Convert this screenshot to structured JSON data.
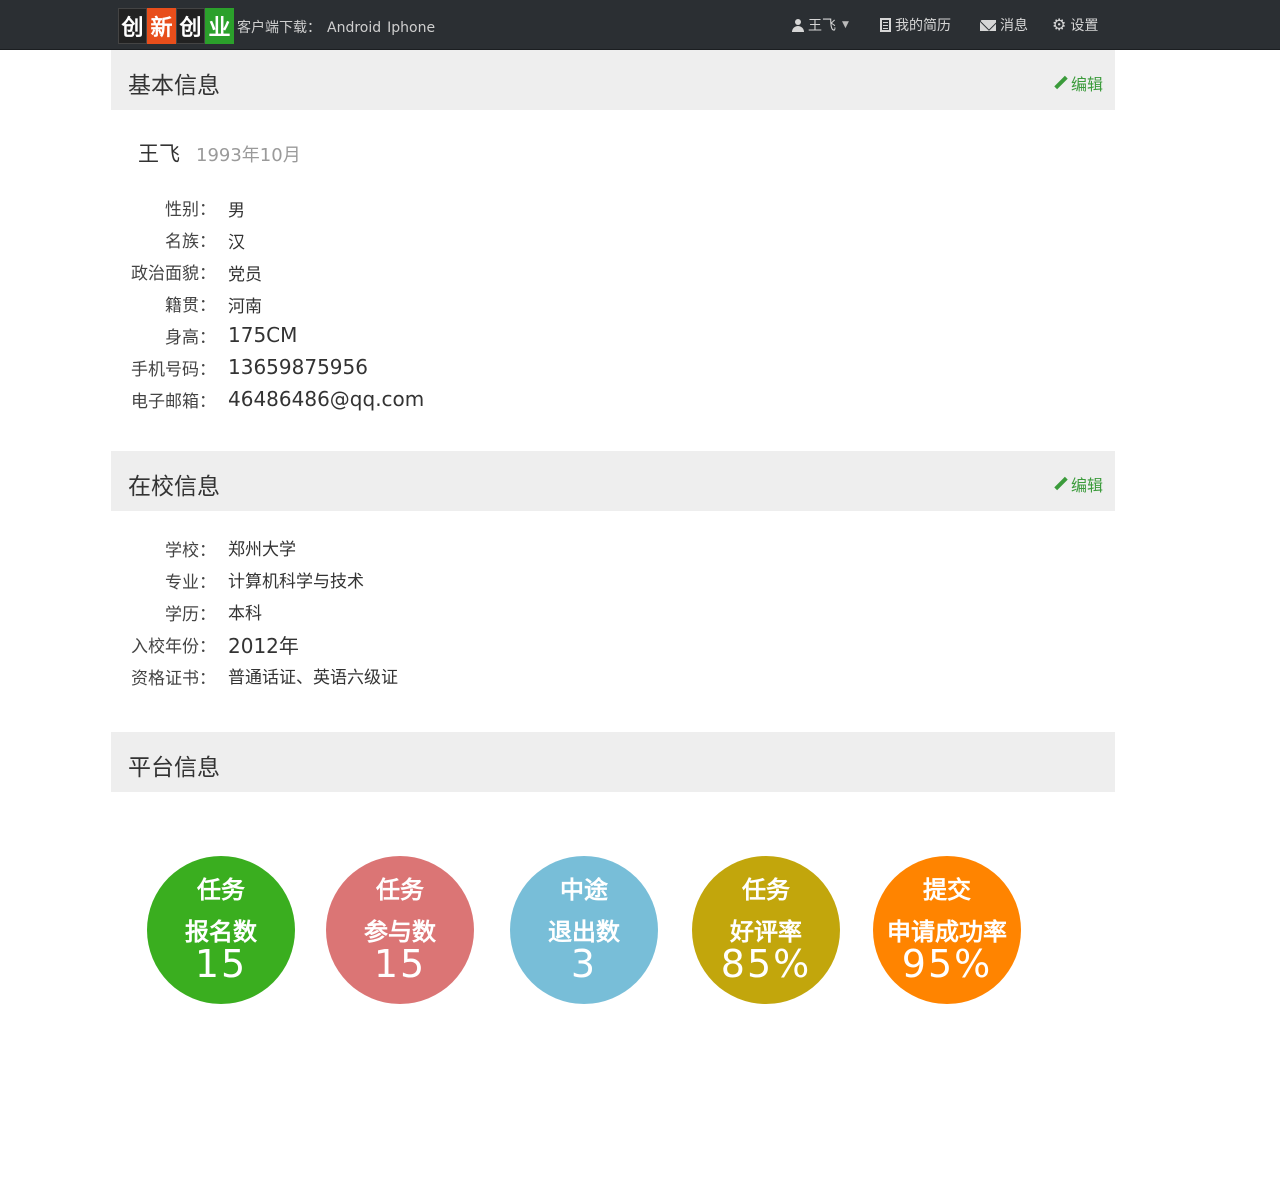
{
  "navbar": {
    "logo_chars": [
      "创",
      "新",
      "创",
      "业"
    ],
    "download_label": "客户端下载：",
    "download_android": "Android",
    "download_iphone": "Iphone",
    "user_name": "王飞",
    "caret": "▼",
    "resume": "我的简历",
    "messages": "消息",
    "settings": "设置"
  },
  "basic": {
    "title": "基本信息",
    "edit": "编辑",
    "name": "王飞",
    "birth": "1993年10月",
    "fields": [
      {
        "label": "性别：",
        "value": "男"
      },
      {
        "label": "名族：",
        "value": "汉"
      },
      {
        "label": "政治面貌：",
        "value": "党员"
      },
      {
        "label": "籍贯：",
        "value": "河南"
      },
      {
        "label": "身高：",
        "value": "175CM"
      },
      {
        "label": "手机号码：",
        "value": "13659875956"
      },
      {
        "label": "电子邮箱：",
        "value": "46486486@qq.com"
      }
    ]
  },
  "school": {
    "title": "在校信息",
    "edit": "编辑",
    "fields": [
      {
        "label": "学校：",
        "value": "郑州大学"
      },
      {
        "label": "专业：",
        "value": "计算机科学与技术"
      },
      {
        "label": "学历：",
        "value": "本科"
      },
      {
        "label": "入校年份：",
        "value": "2012年"
      },
      {
        "label": "资格证书：",
        "value": "普通话证、英语六级证"
      }
    ]
  },
  "platform": {
    "title": "平台信息",
    "stats": [
      {
        "line1": "任务",
        "line2": "报名数",
        "value": "15",
        "color": "#3aae1f"
      },
      {
        "line1": "任务",
        "line2": "参与数",
        "value": "15",
        "color": "#db7575"
      },
      {
        "line1": "中途",
        "line2": "退出数",
        "value": "3",
        "color": "#78bed8"
      },
      {
        "line1": "任务",
        "line2": "好评率",
        "value": "85%",
        "color": "#c2a60c"
      },
      {
        "line1": "提交",
        "line2": "申请成功率",
        "value": "95%",
        "color": "#ff8400"
      }
    ]
  }
}
